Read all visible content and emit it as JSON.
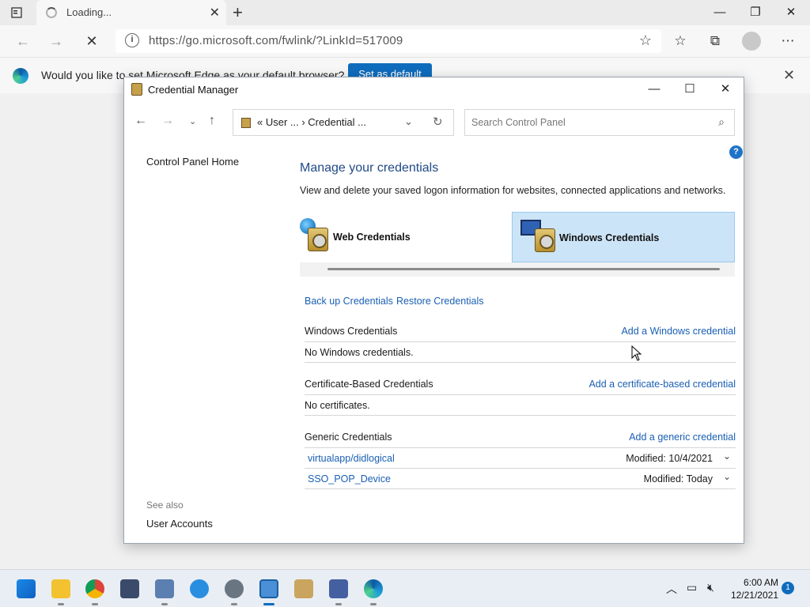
{
  "browser": {
    "tab_title": "Loading...",
    "url": "https://go.microsoft.com/fwlink/?LinkId=517009",
    "infobar_text": "Would you like to set Microsoft Edge as your default browser?",
    "set_default_label": "Set as default"
  },
  "window": {
    "title": "Credential Manager",
    "breadcrumb": "«  User ...  ›  Credential ...",
    "search_placeholder": "Search Control Panel"
  },
  "sidebar": {
    "home": "Control Panel Home",
    "see_also": "See also",
    "user_accounts": "User Accounts"
  },
  "main": {
    "heading": "Manage your credentials",
    "description": "View and delete your saved logon information for websites, connected applications and networks.",
    "tabs": {
      "web": "Web Credentials",
      "windows": "Windows Credentials",
      "selected": "windows"
    },
    "backup_link": "Back up Credentials",
    "restore_link": "Restore Credentials",
    "windows_section": {
      "title": "Windows Credentials",
      "action": "Add a Windows credential",
      "empty": "No Windows credentials."
    },
    "cert_section": {
      "title": "Certificate-Based Credentials",
      "action": "Add a certificate-based credential",
      "empty": "No certificates."
    },
    "generic_section": {
      "title": "Generic Credentials",
      "action": "Add a generic credential",
      "items": [
        {
          "name": "virtualapp/didlogical",
          "modified": "Modified:  10/4/2021"
        },
        {
          "name": "SSO_POP_Device",
          "modified": "Modified:  Today"
        }
      ]
    }
  },
  "taskbar": {
    "time": "6:00 AM",
    "date": "12/21/2021",
    "notifications": "1"
  },
  "colors": {
    "accent": "#0f6cbd",
    "link": "#1a5fb4",
    "selected_tab": "#cce4f7"
  }
}
